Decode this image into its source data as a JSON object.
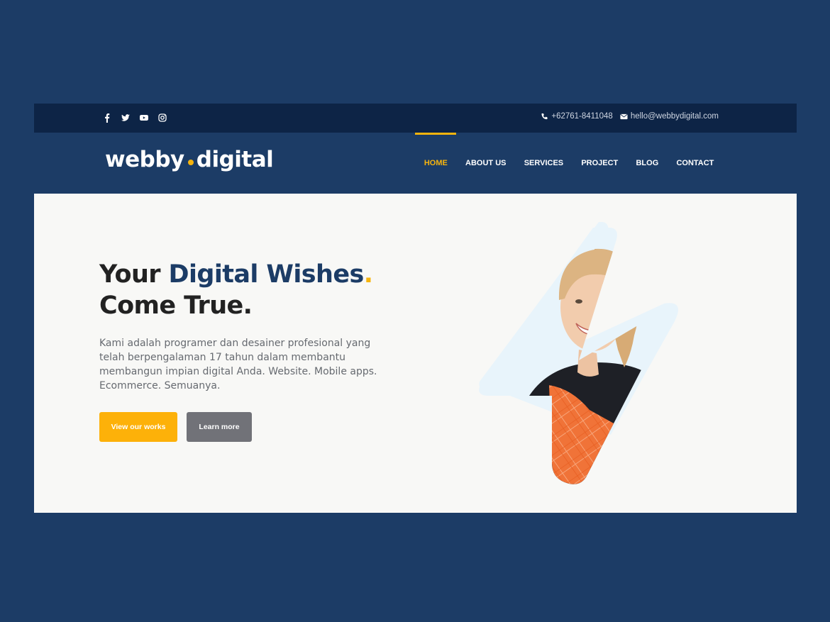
{
  "topbar": {
    "social_icons": [
      "facebook-icon",
      "twitter-icon",
      "youtube-icon",
      "instagram-icon"
    ],
    "phone": "+62761-8411048",
    "email": "hello@webbydigital.com"
  },
  "brand": {
    "part1": "webby",
    "part2": "digital",
    "accent_color": "#f6b40e",
    "navy_color": "#1c3c66"
  },
  "nav": {
    "items": [
      "HOME",
      "ABOUT US",
      "SERVICES",
      "PROJECT",
      "BLOG",
      "CONTACT"
    ],
    "active": "HOME"
  },
  "hero": {
    "headline_1": "Your ",
    "headline_accent": "Digital Wishes",
    "headline_period": ".",
    "headline_2": "Come True.",
    "description": "Kami adalah programer dan desainer profesional yang telah berpengalaman 17 tahun dalam membantu membangun impian digital Anda. Website. Mobile apps. Ecommerce. Semuanya.",
    "primary_button": "View our works",
    "secondary_button": "Learn more"
  }
}
